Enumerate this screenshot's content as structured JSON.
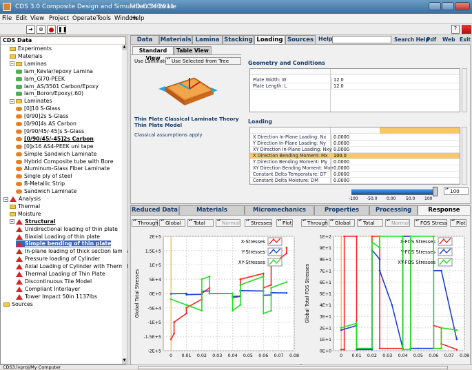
{
  "window": {
    "app_title": "CDS 3.0   Composite Design and Simulation Software",
    "file_title": "UD-CCM 2011"
  },
  "menu": [
    "File",
    "Edit",
    "View",
    "Project",
    "Operate",
    "Tools",
    "Window",
    "Help"
  ],
  "toolbar": {
    "icons": [
      "arrow-icon",
      "pointer-icon",
      "stop-icon",
      "pause-icon"
    ],
    "help_glyph": "?"
  },
  "tree": {
    "header": "CDS Data",
    "items": [
      {
        "label": "Experiments",
        "icon": "experiments-icon",
        "level": 1
      },
      {
        "label": "Materials",
        "icon": "materials-icon",
        "level": 1
      },
      {
        "label": "Laminas",
        "icon": "folder-icon",
        "level": 1
      },
      {
        "label": "lam_Kevlar/epoxy Lamina",
        "icon": "lamina-icon",
        "level": 2
      },
      {
        "label": "lam_Gl70-PEEK",
        "icon": "lamina-icon",
        "level": 2
      },
      {
        "label": "lam_AS/3501 Carbon/Epoxy",
        "icon": "lamina-icon",
        "level": 2
      },
      {
        "label": "lam_Boron/Epoxy(.60)",
        "icon": "lamina-icon",
        "level": 2
      },
      {
        "label": "Laminates",
        "icon": "folder-icon",
        "level": 1
      },
      {
        "label": "[0]10 S-Glass",
        "icon": "laminate-icon",
        "level": 2
      },
      {
        "label": "[0/90]2s S-Glass",
        "icon": "laminate-icon",
        "level": 2
      },
      {
        "label": "[0/90]4s AS Carbon",
        "icon": "laminate-icon",
        "level": 2
      },
      {
        "label": "[0/90/45/-45]s S-Glass",
        "icon": "laminate-icon",
        "level": 2
      },
      {
        "label": "[0/90/45/-45]2s Carbon",
        "icon": "laminate-icon",
        "level": 2,
        "bold": true
      },
      {
        "label": "[0]x16 AS4-PEEK uni tape",
        "icon": "laminate-icon",
        "level": 2
      },
      {
        "label": "Simple Sandwich Laminate",
        "icon": "laminate-icon",
        "level": 2
      },
      {
        "label": "Hybrid Composite tube with Bore",
        "icon": "laminate-icon",
        "level": 2
      },
      {
        "label": "Aluminum-Glass Fiber Laminate",
        "icon": "laminate-icon",
        "level": 2
      },
      {
        "label": "Single ply of steel",
        "icon": "laminate-icon",
        "level": 2
      },
      {
        "label": "B-Metallic Strip",
        "icon": "laminate-icon",
        "level": 2
      },
      {
        "label": "Sandwich Laminate",
        "icon": "laminate-icon",
        "level": 2
      },
      {
        "label": "Analysis",
        "icon": "analysis-icon",
        "level": 0
      },
      {
        "label": "Thermal",
        "icon": "thermal-icon",
        "level": 1
      },
      {
        "label": "Moisture",
        "icon": "moisture-icon",
        "level": 1
      },
      {
        "label": "Structural",
        "icon": "structural-icon",
        "level": 1,
        "bold": true
      },
      {
        "label": "Unidirectional loading of thin plate",
        "icon": "case-icon",
        "level": 2
      },
      {
        "label": "Biaxial Loading of thin plate",
        "icon": "case-icon",
        "level": 2
      },
      {
        "label": "Simple bending of thin plate",
        "icon": "case-icon",
        "level": 2,
        "selected": true,
        "bold": true
      },
      {
        "label": "In-plane loading of thick section laminate",
        "icon": "case-icon",
        "level": 2
      },
      {
        "label": "Pressure loading of Cylinder",
        "icon": "case-icon",
        "level": 2
      },
      {
        "label": "Axial Loading of Cylinder with Thermal Loa",
        "icon": "case-icon",
        "level": 2
      },
      {
        "label": "Thermal Loading of Thin Plate",
        "icon": "case-icon",
        "level": 2
      },
      {
        "label": "Discontinuous Tile Model",
        "icon": "case-icon",
        "level": 2
      },
      {
        "label": "Compliant Interlayer",
        "icon": "case-icon",
        "level": 2
      },
      {
        "label": "Tower Impact 50in 1137lbs",
        "icon": "case-icon",
        "level": 2
      },
      {
        "label": "Sources",
        "icon": "sources-icon",
        "level": 0
      }
    ]
  },
  "status": {
    "path": "CDS3.lvproj/My Computer"
  },
  "top_tabs": [
    "Data",
    "Materials",
    "Lamina",
    "Stacking",
    "Loading",
    "Sources",
    "Help"
  ],
  "active_tab": "Loading",
  "links": [
    "Search Help",
    "Pdf",
    "Web",
    "Exit"
  ],
  "view_tabs": [
    "Standard View",
    "Table View"
  ],
  "use_laminate": {
    "label": "Use Laminate",
    "value": "Use Selected from Tree"
  },
  "model": {
    "title": "Thin Plate Classical Laminate Theory",
    "subtitle": "Thin Plate Model",
    "assumptions": "Classical assumptions apply"
  },
  "geometry": {
    "title": "Geometry and Conditions",
    "rows": [
      {
        "label": "Plate Width: W",
        "value": "12.0"
      },
      {
        "label": "Plate Length: L",
        "value": "12.0"
      }
    ]
  },
  "loading": {
    "title": "Loading",
    "rows": [
      {
        "label": "X Direction In-Plane Loading: Nx",
        "value": "0.0000"
      },
      {
        "label": "Y Direction In-Plane Loading: Ny",
        "value": "0.0000"
      },
      {
        "label": "XY Direction In-Plane Loading: Nxy",
        "value": "0.0000"
      },
      {
        "label": "X Direction Bending Moment: Mx",
        "value": "100.0",
        "highlight": true
      },
      {
        "label": "Y Direction Bending Moment: My",
        "value": "0.0000"
      },
      {
        "label": "XY Direction Bending Moment: Mxy",
        "value": "0.0000"
      },
      {
        "label": "Constant Delta Temperature: DT",
        "value": "0.0000"
      },
      {
        "label": "Constant Delta Moisture: DM",
        "value": "0.0000"
      }
    ]
  },
  "slider": {
    "value": "100",
    "level": 1.0,
    "ticks": [
      "-100",
      "-50.0",
      "0.00",
      "50.0",
      "100"
    ]
  },
  "bottom_tabs": [
    "Reduced Data",
    "Materials Summary",
    "Micromechanics",
    "Properties",
    "Processing",
    "",
    "Response"
  ],
  "active_bottom_tab": "Response",
  "left_plot_controls": [
    "Through",
    "Global",
    "Total",
    "Normal",
    "Stresses",
    "Plot"
  ],
  "right_plot_controls": [
    "Through",
    "Global",
    "Total",
    "Normal",
    "FOS Stress",
    "Plot"
  ],
  "colors": {
    "x": "#ff2020",
    "y": "#1c3fd6",
    "xy": "#1fe01f",
    "plot_bg": "#ffffff",
    "grid": "#d8d8d8"
  },
  "chart_data": [
    {
      "type": "line",
      "ylabel": "Global Total Stresses",
      "xlim": [
        -0.005,
        0.08
      ],
      "ylim": [
        -200000.0,
        200000.0
      ],
      "xticks": [
        "0",
        "0.01",
        "0.02",
        "0.03",
        "0.04",
        "0.05",
        "0.06",
        "0.07",
        "0.08"
      ],
      "yticks": [
        "2E+5",
        "1.5E+5",
        "1E+5",
        "5E+4",
        "0E+0",
        "-5E+4",
        "-1E+5",
        "-1.5E+5",
        "-2E+5"
      ],
      "legend_position": "top-right",
      "series": [
        {
          "name": "X-Stresses",
          "x": [
            0,
            0.002,
            0.002,
            0.01,
            0.01,
            0.02,
            0.02,
            0.025,
            0.025,
            0.04,
            0.04,
            0.045,
            0.045,
            0.06,
            0.06,
            0.065,
            0.065,
            0.07,
            0.075,
            0.075
          ],
          "y": [
            -160000.0,
            -140000.0,
            -100000.0,
            -70000.0,
            -50000.0,
            -20000.0,
            0,
            20000.0,
            0,
            0,
            -15000.0,
            -10000.0,
            50000.0,
            70000.0,
            20000.0,
            30000.0,
            100000.0,
            120000.0,
            140000.0,
            160000.0
          ]
        },
        {
          "name": "Y-Stresses",
          "x": [
            0,
            0.01,
            0.01,
            0.02,
            0.02,
            0.025,
            0.025,
            0.04,
            0.04,
            0.045,
            0.045,
            0.06,
            0.06,
            0.065,
            0.065,
            0.075
          ],
          "y": [
            -1000.0,
            0,
            -4000.0,
            -3000.0,
            8000.0,
            9000.0,
            0,
            0,
            -10000.0,
            -9000.0,
            10000.0,
            9000.0,
            -6000.0,
            -5000.0,
            3000.0,
            2000.0
          ]
        },
        {
          "name": "XY-Stresses",
          "x": [
            0,
            0.01,
            0.01,
            0.02,
            0.02,
            0.025,
            0.025,
            0.04,
            0.04,
            0.045,
            0.045,
            0.06,
            0.06,
            0.065,
            0.065,
            0.075
          ],
          "y": [
            -20000.0,
            -40000.0,
            -40000.0,
            -60000.0,
            50000.0,
            60000.0,
            0,
            0,
            -60000.0,
            -40000.0,
            30000.0,
            60000.0,
            -70000.0,
            -60000.0,
            20000.0,
            40000.0
          ]
        }
      ]
    },
    {
      "type": "line",
      "ylabel": "Global Total FOS Stresses",
      "xlim": [
        -0.005,
        0.08
      ],
      "ylim": [
        0,
        100.0
      ],
      "xticks": [
        "0",
        "0.01",
        "0.02",
        "0.03",
        "0.04",
        "0.05",
        "0.06",
        "0.07",
        "0.08"
      ],
      "yticks": [
        "1E+2",
        "9E+1",
        "8E+1",
        "7E+1",
        "6E+1",
        "5E+1",
        "4E+1",
        "3E+1",
        "2E+1",
        "1E+1",
        "0E+0"
      ],
      "legend_position": "top-right",
      "series": [
        {
          "name": "X-FOS Stresses",
          "x": [
            0,
            0.002,
            0.002,
            0.01,
            0.01,
            0.02,
            0.02,
            0.025,
            0.025,
            0.04,
            0.04,
            0.045,
            0.045,
            0.06,
            0.06,
            0.065,
            0.065,
            0.075
          ],
          "y": [
            1,
            1,
            100,
            100,
            2,
            2,
            100,
            100,
            2,
            2,
            100,
            100,
            2,
            2,
            22,
            20,
            6,
            1
          ]
        },
        {
          "name": "Y-FOS Stresses",
          "x": [
            0,
            0.01,
            0.01,
            0.02,
            0.02,
            0.025,
            0.025,
            0.033,
            0.04,
            0.04,
            0.045,
            0.045,
            0.06,
            0.06,
            0.065,
            0.075
          ],
          "y": [
            18,
            22,
            1,
            1,
            88,
            80,
            70,
            40,
            2,
            100,
            100,
            2,
            2,
            70,
            70,
            10
          ]
        },
        {
          "name": "XY-FOS Stresses",
          "x": [
            0,
            0.01,
            0.01,
            0.02,
            0.02,
            0.025,
            0.025,
            0.04,
            0.04,
            0.045,
            0.045,
            0.06,
            0.06,
            0.065,
            0.065,
            0.075
          ],
          "y": [
            20,
            24,
            2,
            2,
            95,
            90,
            100,
            100,
            1,
            1,
            100,
            100,
            2,
            2,
            20,
            18
          ]
        }
      ]
    }
  ]
}
